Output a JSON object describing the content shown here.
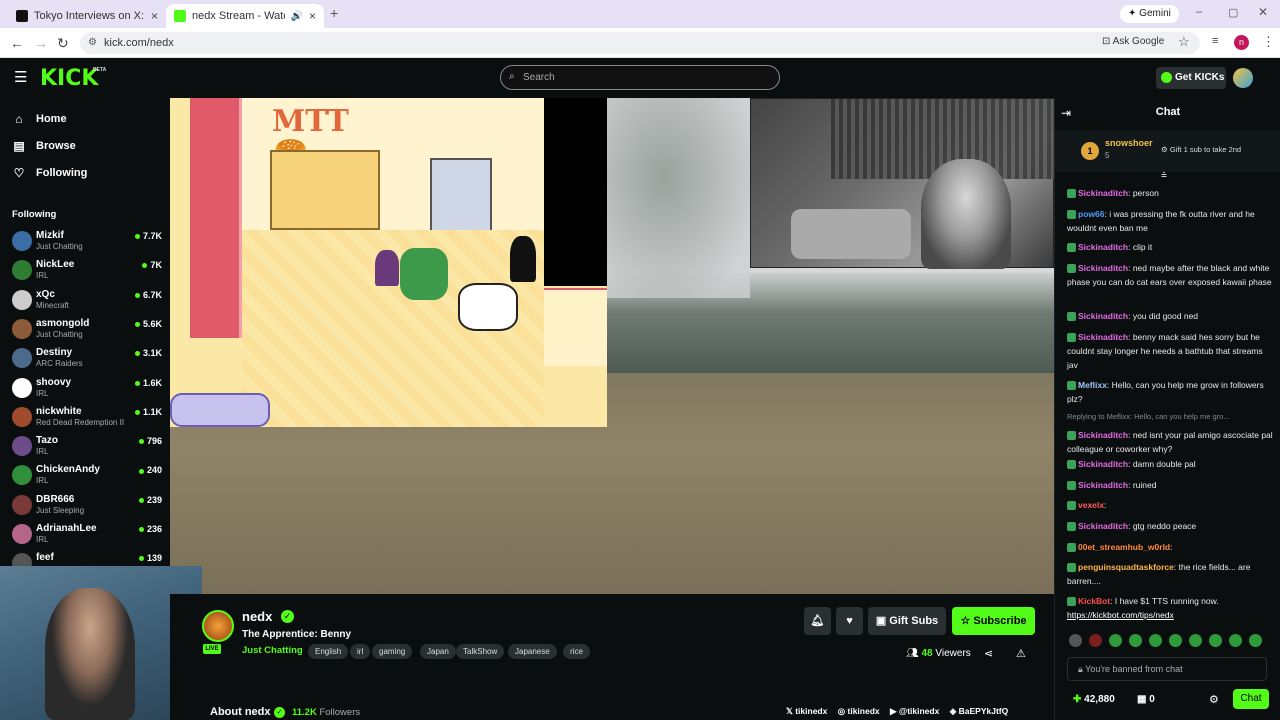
{
  "browser": {
    "tabs": [
      {
        "title": "Tokyo Interviews on X: \"@calli",
        "active": false
      },
      {
        "title": "nedx Stream - Watch Live o",
        "active": true
      }
    ],
    "new_tab": "+",
    "gemini_label": "Gemini",
    "url": "kick.com/nedx",
    "ask_google": "Ask Google",
    "profile_initial": "n"
  },
  "header": {
    "logo": "KICK",
    "beta": "BETA",
    "search_placeholder": "Search",
    "get_kicks": "Get KICKs"
  },
  "sidebar": {
    "nav": [
      {
        "label": "Home",
        "icon": "home-icon"
      },
      {
        "label": "Browse",
        "icon": "browse-icon"
      },
      {
        "label": "Following",
        "icon": "heart-icon"
      }
    ],
    "following_title": "Following",
    "channels": [
      {
        "name": "Mizkif",
        "category": "Just Chatting",
        "viewers": "7.7K",
        "color": "#3a6ea5"
      },
      {
        "name": "NickLee",
        "category": "IRL",
        "viewers": "7K",
        "color": "#2e7d32"
      },
      {
        "name": "xQc",
        "category": "Minecraft",
        "viewers": "6.7K",
        "color": "#cccccc"
      },
      {
        "name": "asmongold",
        "category": "Just Chatting",
        "viewers": "5.6K",
        "color": "#8e5b3a"
      },
      {
        "name": "Destiny",
        "category": "ARC Raiders",
        "viewers": "3.1K",
        "color": "#4c6a8a"
      },
      {
        "name": "shoovy",
        "category": "IRL",
        "viewers": "1.6K",
        "color": "#ffffff"
      },
      {
        "name": "nickwhite",
        "category": "Red Dead Redemption II",
        "viewers": "1.1K",
        "color": "#a04b2e"
      },
      {
        "name": "Tazo",
        "category": "IRL",
        "viewers": "796",
        "color": "#6d4c8a"
      },
      {
        "name": "ChickenAndy",
        "category": "IRL",
        "viewers": "240",
        "color": "#2f8f3a"
      },
      {
        "name": "DBR666",
        "category": "Just Sleeping",
        "viewers": "239",
        "color": "#7a3a3a"
      },
      {
        "name": "AdrianahLee",
        "category": "IRL",
        "viewers": "236",
        "color": "#b5658a"
      },
      {
        "name": "feef",
        "category": "",
        "viewers": "139",
        "color": "#555555"
      }
    ]
  },
  "stream": {
    "channel": "nedx",
    "title": "The Apprentice: Benny",
    "category": "Just Chatting",
    "live_label": "LIVE",
    "tags": [
      "English",
      "irl",
      "gaming",
      "Japan",
      "TalkShow",
      "Japanese",
      "rice"
    ],
    "viewers": "48",
    "viewers_label": "Viewers",
    "gift_subs": "Gift Subs",
    "subscribe": "Subscribe",
    "about": "About nedx",
    "followers": "11.2K",
    "followers_label": "Followers",
    "socials": [
      "tikinedx",
      "tikinedx",
      "@tikinedx",
      "BaEPYkJtfQ"
    ]
  },
  "chat": {
    "title": "Chat",
    "pinned_user": "snowshoer",
    "pinned_count": "5",
    "pinned_rank": "1",
    "gift_prompt": "Gift 1 sub to take 2nd",
    "messages": [
      {
        "user": "Sickinaditch",
        "text": "person",
        "color": "#e36be3"
      },
      {
        "user": "pow66",
        "text": "i was pressing the fk outta river and he wouldnt even ban me",
        "color": "#4f9cff"
      },
      {
        "user": "Sickinaditch",
        "text": "clip it",
        "color": "#e36be3"
      },
      {
        "user": "Sickinaditch",
        "text": "ned maybe after the black and white phase you can do cat ears over exposed kawaii phase",
        "color": "#e36be3"
      },
      {
        "user": "Sickinaditch",
        "text": "you did good ned",
        "color": "#e36be3"
      },
      {
        "user": "Sickinaditch",
        "text": "benny mack said hes sorry but he couldnt stay longer he needs a bathtub that streams jav",
        "color": "#e36be3"
      },
      {
        "user": "Meflixx",
        "text": "Hello, can you help me grow in followers plz?",
        "color": "#9fc5ff"
      },
      {
        "user": "Sickinaditch",
        "text": "ned isnt your pal amigo ascociate pal colleague or coworker why?",
        "color": "#e36be3",
        "reply": "Replying to Meflixx: Hello, can you help me gro..."
      },
      {
        "user": "Sickinaditch",
        "text": "damn double pal",
        "color": "#e36be3"
      },
      {
        "user": "Sickinaditch",
        "text": "ruined",
        "color": "#e36be3"
      },
      {
        "user": "vexelx",
        "text": "",
        "color": "#ff5b5b"
      },
      {
        "user": "Sickinaditch",
        "text": "gtg neddo peace",
        "color": "#e36be3"
      },
      {
        "user": "00et_streamhub_w0rld",
        "text": "",
        "color": "#ff8a3d"
      },
      {
        "user": "penguinsquadtaskforce",
        "text": "the rice fields... are barren....",
        "color": "#ffb347"
      },
      {
        "user": "KickBot",
        "text": "I have $1 TTS running now.",
        "color": "#ff4d4d",
        "link": "https://kickbot.com/tips/nedx"
      }
    ],
    "banned": "You're banned from chat",
    "points": "42,880",
    "gifts": "0",
    "send": "Chat"
  },
  "colors": {
    "accent": "#53fc18",
    "bg": "#0b0e0f",
    "panel": "#1d2224"
  }
}
